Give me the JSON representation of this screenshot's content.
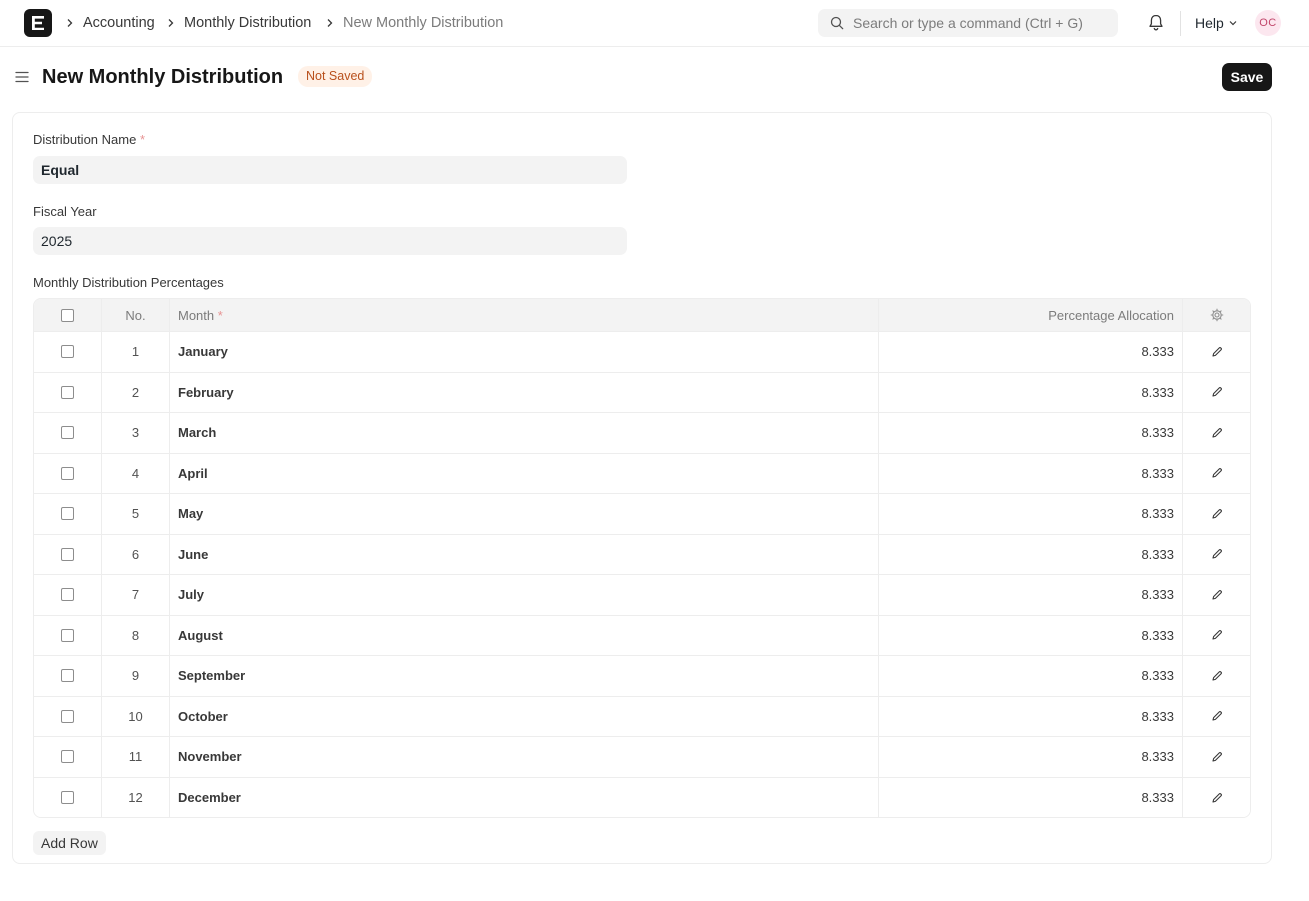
{
  "breadcrumbs": [
    "Accounting",
    "Monthly Distribution",
    "New Monthly Distribution"
  ],
  "search": {
    "placeholder": "Search or type a command (Ctrl + G)"
  },
  "nav": {
    "help_label": "Help",
    "avatar_initials": "OC"
  },
  "page": {
    "title": "New Monthly Distribution",
    "status": "Not Saved",
    "save_label": "Save"
  },
  "form": {
    "distribution_name": {
      "label": "Distribution Name",
      "value": "Equal"
    },
    "fiscal_year": {
      "label": "Fiscal Year",
      "value": "2025"
    },
    "table_label": "Monthly Distribution Percentages"
  },
  "table": {
    "headers": {
      "no": "No.",
      "month": "Month",
      "percentage": "Percentage Allocation"
    },
    "rows": [
      {
        "no": "1",
        "month": "January",
        "percentage": "8.333"
      },
      {
        "no": "2",
        "month": "February",
        "percentage": "8.333"
      },
      {
        "no": "3",
        "month": "March",
        "percentage": "8.333"
      },
      {
        "no": "4",
        "month": "April",
        "percentage": "8.333"
      },
      {
        "no": "5",
        "month": "May",
        "percentage": "8.333"
      },
      {
        "no": "6",
        "month": "June",
        "percentage": "8.333"
      },
      {
        "no": "7",
        "month": "July",
        "percentage": "8.333"
      },
      {
        "no": "8",
        "month": "August",
        "percentage": "8.333"
      },
      {
        "no": "9",
        "month": "September",
        "percentage": "8.333"
      },
      {
        "no": "10",
        "month": "October",
        "percentage": "8.333"
      },
      {
        "no": "11",
        "month": "November",
        "percentage": "8.333"
      },
      {
        "no": "12",
        "month": "December",
        "percentage": "8.333"
      }
    ],
    "add_row_label": "Add Row"
  },
  "colors": {
    "primary_button": "#171717",
    "status_badge_bg": "#fff1e7",
    "status_badge_text": "#b9501c",
    "required_marker": "#e79393"
  }
}
